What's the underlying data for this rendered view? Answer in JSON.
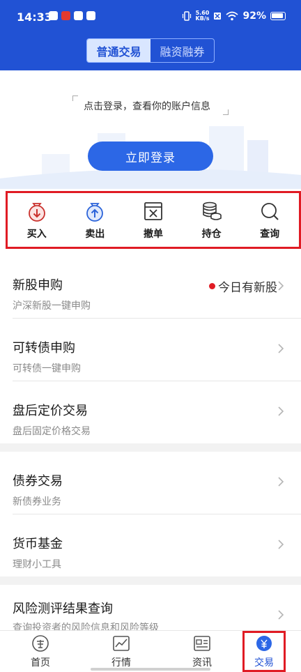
{
  "status": {
    "time": "14:33",
    "speed_value": "5.60",
    "speed_unit": "KB/s",
    "battery": "92%"
  },
  "segment": {
    "tabs": [
      {
        "label": "普通交易",
        "active": true
      },
      {
        "label": "融资融券",
        "active": false
      }
    ]
  },
  "login": {
    "prompt": "点击登录，查看你的账户信息",
    "button": "立即登录"
  },
  "quick_actions": [
    {
      "label": "买入",
      "icon": "buy-icon"
    },
    {
      "label": "卖出",
      "icon": "sell-icon"
    },
    {
      "label": "撤单",
      "icon": "cancel-order-icon"
    },
    {
      "label": "持仓",
      "icon": "holdings-icon"
    },
    {
      "label": "查询",
      "icon": "search-icon"
    }
  ],
  "groups": [
    [
      {
        "title": "新股申购",
        "subtitle": "沪深新股一键申购",
        "tag": "今日有新股"
      },
      {
        "title": "可转债申购",
        "subtitle": "可转债一键申购"
      },
      {
        "title": "盘后定价交易",
        "subtitle": "盘后固定价格交易"
      }
    ],
    [
      {
        "title": "债券交易",
        "subtitle": "新债券业务"
      },
      {
        "title": "货币基金",
        "subtitle": "理财小工具"
      }
    ],
    [
      {
        "title": "风险测评结果查询",
        "subtitle": "查询投资者的风险信息和风险等级"
      }
    ]
  ],
  "tabbar": [
    {
      "label": "首页",
      "icon": "home-icon"
    },
    {
      "label": "行情",
      "icon": "market-icon"
    },
    {
      "label": "资讯",
      "icon": "news-icon"
    },
    {
      "label": "交易",
      "icon": "trade-icon",
      "active": true
    }
  ],
  "colors": {
    "brand_blue": "#2152d4",
    "button_blue": "#2c67e6",
    "highlight_red": "#e01b24"
  }
}
